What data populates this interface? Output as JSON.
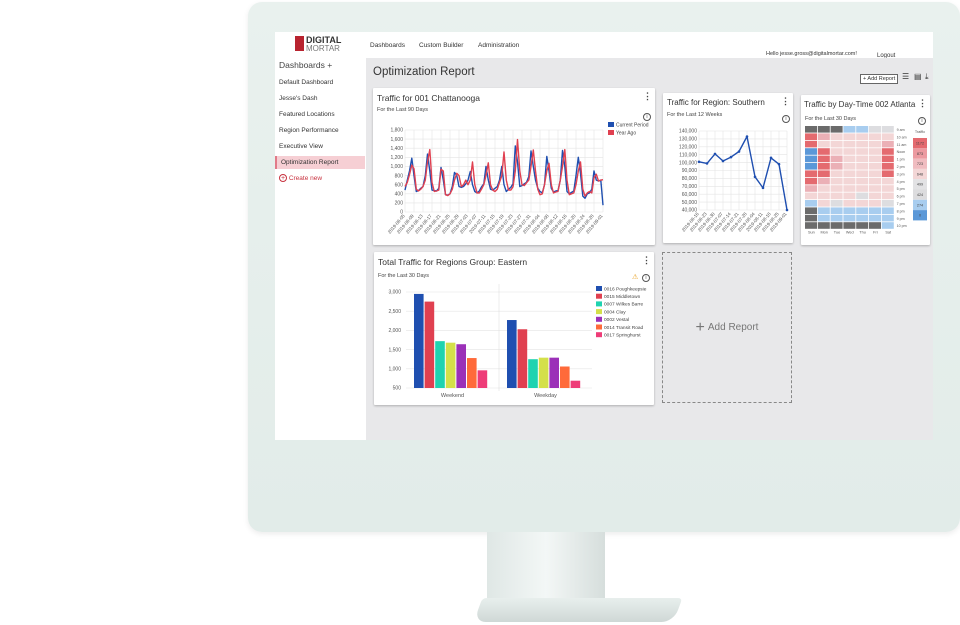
{
  "header": {
    "logo_line1": "DIGITAL",
    "logo_line2": "MORTAR",
    "nav": [
      "Dashboards",
      "Custom Builder",
      "Administration"
    ],
    "greeting": "Hello jesse.gross@digitalmortar.com!",
    "logout": "Logout"
  },
  "sidebar": {
    "title": "Dashboards",
    "add": "+",
    "items": [
      "Default Dashboard",
      "Jesse's Dash",
      "Featured Locations",
      "Region Performance",
      "Executive View",
      "Optimization Report"
    ],
    "active": "Optimization Report",
    "create": "Create new"
  },
  "page": {
    "title": "Optimization Report",
    "add_report": "+ Add Report",
    "add_report_tile": "Add Report"
  },
  "colors": {
    "current": "#1f4fb0",
    "year_ago": "#e04050",
    "accent": "#b8232f"
  },
  "chart_data": [
    {
      "type": "line",
      "title": "Traffic for 001 Chattanooga",
      "subtitle": "For the Last 90 Days",
      "ylim": [
        0,
        1800
      ],
      "yticks": [
        "0",
        "200",
        "400",
        "600",
        "800",
        "1,000",
        "1,200",
        "1,400",
        "1,600",
        "1,800"
      ],
      "xticks": [
        "2019-06-05",
        "2019-06-09",
        "2019-06-13",
        "2019-06-17",
        "2019-06-21",
        "2019-06-25",
        "2019-06-29",
        "2019-07-03",
        "2019-07-07",
        "2019-07-11",
        "2019-07-15",
        "2019-07-19",
        "2019-07-23",
        "2019-07-27",
        "2019-07-31",
        "2019-08-04",
        "2019-08-08",
        "2019-08-12",
        "2019-08-16",
        "2019-08-20",
        "2019-08-24",
        "2019-08-28",
        "2019-09-01"
      ],
      "grid": true,
      "legend": "right",
      "series": [
        {
          "name": "Current Period",
          "color": "#1f4fb0",
          "values": [
            480,
            700,
            900,
            1180,
            800,
            450,
            470,
            520,
            560,
            800,
            1270,
            900,
            480,
            470,
            460,
            520,
            980,
            700,
            380,
            370,
            400,
            560,
            870,
            800,
            560,
            540,
            560,
            620,
            700,
            890,
            600,
            450,
            420,
            460,
            550,
            620,
            1000,
            700,
            500,
            480,
            520,
            560,
            700,
            1000,
            600,
            450,
            500,
            540,
            620,
            1450,
            1100,
            560,
            580,
            620,
            650,
            780,
            1340,
            1000,
            700,
            520,
            450,
            420,
            600,
            1220,
            900,
            520,
            440,
            460,
            470,
            700,
            1350,
            1000,
            450,
            400,
            430,
            460,
            800,
            1200,
            850,
            350,
            300,
            400,
            420,
            500,
            900,
            700,
            680,
            700,
            150
          ]
        },
        {
          "name": "Year Ago",
          "color": "#e04050",
          "values": [
            560,
            650,
            820,
            1030,
            950,
            500,
            460,
            500,
            560,
            700,
            1100,
            1370,
            650,
            450,
            460,
            480,
            940,
            900,
            380,
            360,
            400,
            500,
            700,
            850,
            800,
            560,
            600,
            700,
            600,
            700,
            1100,
            600,
            420,
            420,
            500,
            600,
            800,
            1080,
            600,
            480,
            450,
            500,
            650,
            800,
            1320,
            700,
            480,
            480,
            550,
            900,
            1590,
            900,
            600,
            580,
            640,
            700,
            1000,
            1360,
            900,
            500,
            380,
            400,
            600,
            900,
            1070,
            600,
            420,
            440,
            450,
            700,
            1000,
            1370,
            700,
            380,
            400,
            420,
            600,
            900,
            1100,
            500,
            350,
            420,
            450,
            420,
            750,
            830,
            680,
            700,
            710
          ]
        }
      ]
    },
    {
      "type": "line",
      "title": "Traffic for Region: Southern",
      "subtitle": "For the Last 12 Weeks",
      "ylim": [
        40000,
        140000
      ],
      "yticks": [
        "40,000",
        "50,000",
        "60,000",
        "70,000",
        "80,000",
        "90,000",
        "100,000",
        "110,000",
        "120,000",
        "130,000",
        "140,000"
      ],
      "xticks": [
        "2019-06-16",
        "2019-06-23",
        "2019-06-30",
        "2019-07-07",
        "2019-07-14",
        "2019-07-21",
        "2019-07-28",
        "2019-08-04",
        "2019-08-11",
        "2019-08-18",
        "2019-08-25",
        "2019-09-01"
      ],
      "grid": true,
      "series": [
        {
          "color": "#1f4fb0",
          "values": [
            101000,
            99000,
            111000,
            102000,
            107000,
            114000,
            133000,
            82000,
            68000,
            106000,
            98000,
            40000
          ]
        }
      ]
    },
    {
      "type": "heatmap",
      "title": "Traffic by Day-Time 002 Atlanta",
      "subtitle": "For the Last 30 Days",
      "days": [
        "Sun",
        "Mon",
        "Tue",
        "Wed",
        "Thu",
        "Fri",
        "Sat"
      ],
      "hours": [
        "9 am",
        "10 am",
        "11 am",
        "Noon",
        "1 pm",
        "2 pm",
        "3 pm",
        "4 pm",
        "5 pm",
        "6 pm",
        "7 pm",
        "8 pm",
        "9 pm",
        "10 pm"
      ],
      "legend_title": "Traffic",
      "legend": [
        "1172",
        "873",
        "723",
        "648",
        "499",
        "424",
        "274",
        "0"
      ],
      "legend_colors": [
        "#e46a6f",
        "#ec9aa0",
        "#f0bcc0",
        "#f3d6d6",
        "#e2e2e4",
        "#dcdcde",
        "#a8cdef",
        "#5b98d8"
      ],
      "palette": {
        "D": "#6b6b6b",
        "b": "#5b98d8",
        "l": "#a8cdef",
        "g": "#dddde0",
        "p": "#f3d6d6",
        "m": "#ebb0b6",
        "r": "#e46a6f"
      },
      "cells": [
        "DDDllgg",
        "rmppppp",
        "rpppppm",
        "brppppr",
        "brmpppr",
        "brmpppr",
        "rrppppr",
        "rmppppp",
        "mpppppp",
        "ppppgpp",
        "lpgpppg",
        "Dllllll",
        "Dllllll",
        "DDDDDDl"
      ]
    },
    {
      "type": "bar",
      "title": "Total Traffic for Regions Group: Eastern",
      "subtitle": "For the Last 30 Days",
      "ylim": [
        500,
        3000
      ],
      "yticks": [
        "500",
        "1,000",
        "1,500",
        "2,000",
        "2,500",
        "3,000"
      ],
      "categories": [
        "Weekend",
        "Weekday"
      ],
      "legend": "right",
      "series": [
        {
          "name": "0016 Poughkeepsie",
          "color": "#1f4fb0",
          "values": [
            2950,
            2270
          ]
        },
        {
          "name": "0015 Middletown",
          "color": "#e04050",
          "values": [
            2750,
            2030
          ]
        },
        {
          "name": "0007 Wilkes Barre",
          "color": "#1fd3b0",
          "values": [
            1720,
            1250
          ]
        },
        {
          "name": "0004 Clay",
          "color": "#d4e04a",
          "values": [
            1680,
            1290
          ]
        },
        {
          "name": "0002 Vestal",
          "color": "#9b30b8",
          "values": [
            1640,
            1290
          ]
        },
        {
          "name": "0014 Transit Road",
          "color": "#ff6a3a",
          "values": [
            1280,
            1060
          ]
        },
        {
          "name": "0017 Springhurst",
          "color": "#ee3c78",
          "values": [
            960,
            690
          ]
        }
      ]
    }
  ]
}
